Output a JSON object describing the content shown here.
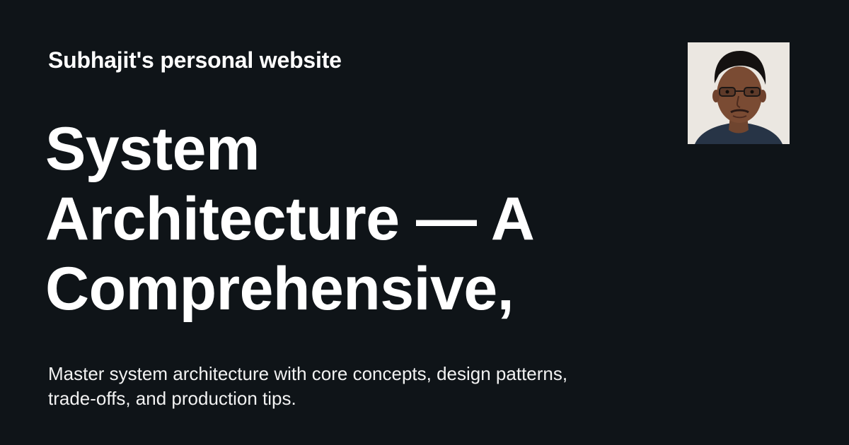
{
  "site": {
    "name": "Subhajit's personal website"
  },
  "post": {
    "title_lines": [
      "System",
      "Architecture — A",
      "Comprehensive,"
    ],
    "description_lines": [
      "Master system architecture with core concepts, design patterns,",
      "trade-offs, and production tips."
    ]
  },
  "colors": {
    "background": "#0f1418",
    "text": "#ffffff"
  },
  "avatar": {
    "icon": "author-avatar-photo"
  }
}
